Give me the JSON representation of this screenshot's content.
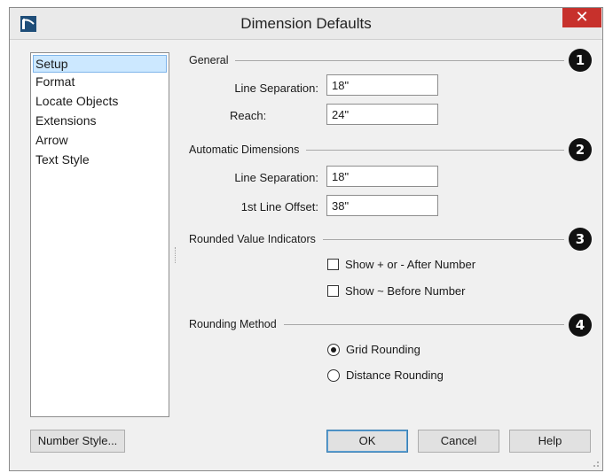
{
  "window": {
    "title": "Dimension Defaults",
    "close_glyph": "✕"
  },
  "sidebar": {
    "items": [
      {
        "label": "Setup",
        "selected": true
      },
      {
        "label": "Format",
        "selected": false
      },
      {
        "label": "Locate Objects",
        "selected": false
      },
      {
        "label": "Extensions",
        "selected": false
      },
      {
        "label": "Arrow",
        "selected": false
      },
      {
        "label": "Text Style",
        "selected": false
      }
    ]
  },
  "general": {
    "heading": "General",
    "callout": "1",
    "line_separation_label": "Line Separation:",
    "line_separation_value": "18\"",
    "reach_label": "Reach:",
    "reach_value": "24\""
  },
  "automatic": {
    "heading": "Automatic Dimensions",
    "callout": "2",
    "line_separation_label": "Line Separation:",
    "line_separation_value": "18\"",
    "first_offset_label": "1st Line Offset:",
    "first_offset_value": "38\""
  },
  "rounded": {
    "heading": "Rounded Value Indicators",
    "callout": "3",
    "show_plus_minus_label": "Show + or - After Number",
    "show_plus_minus_checked": false,
    "show_tilde_label": "Show ~ Before Number",
    "show_tilde_checked": false
  },
  "rounding": {
    "heading": "Rounding Method",
    "callout": "4",
    "grid_label": "Grid Rounding",
    "distance_label": "Distance Rounding",
    "selected": "grid"
  },
  "buttons": {
    "number_style": "Number Style...",
    "ok": "OK",
    "cancel": "Cancel",
    "help": "Help"
  },
  "icons": {
    "app": "app-icon",
    "close": "close-icon",
    "resize": "resize-grip-icon"
  },
  "colors": {
    "close_bg": "#c7312c",
    "selection_bg": "#cce8ff",
    "callout_bg": "#111111",
    "app_icon": "#1f4e79"
  }
}
